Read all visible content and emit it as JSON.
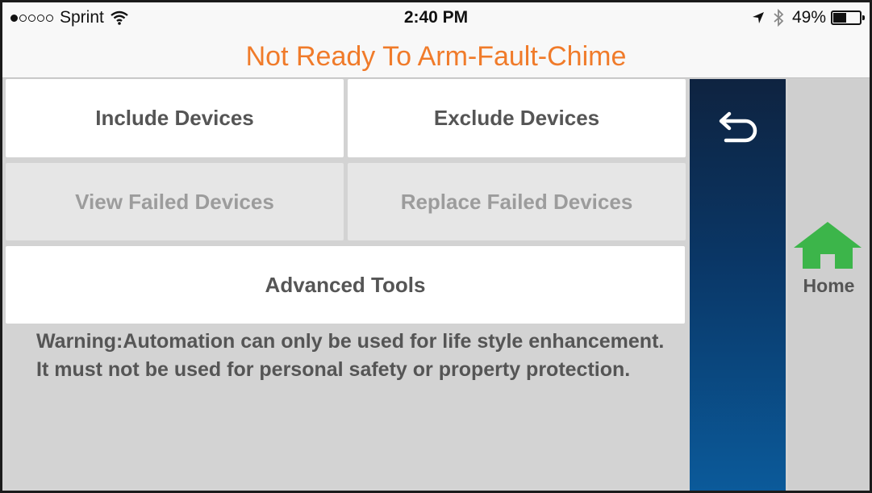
{
  "status_bar": {
    "carrier": "Sprint",
    "time": "2:40 PM",
    "battery": "49%",
    "battery_level": 0.49,
    "signal_bars": 1,
    "icons": [
      "wifi-icon",
      "location-arrow-icon",
      "bluetooth-icon",
      "battery-icon"
    ]
  },
  "header": {
    "title": "Not Ready To Arm-Fault-Chime",
    "title_color": "#f07b2a"
  },
  "buttons": {
    "include": "Include Devices",
    "exclude": "Exclude Devices",
    "view_failed": "View Failed Devices",
    "replace_failed": "Replace Failed Devices",
    "advanced": "Advanced Tools"
  },
  "warning": "Warning:Automation can only be used for life style enhancement. It must not be used for personal safety or property protection.",
  "side": {
    "back_icon": "back-arrow-icon",
    "home_label": "Home",
    "home_icon_color": "#3cb54a"
  }
}
